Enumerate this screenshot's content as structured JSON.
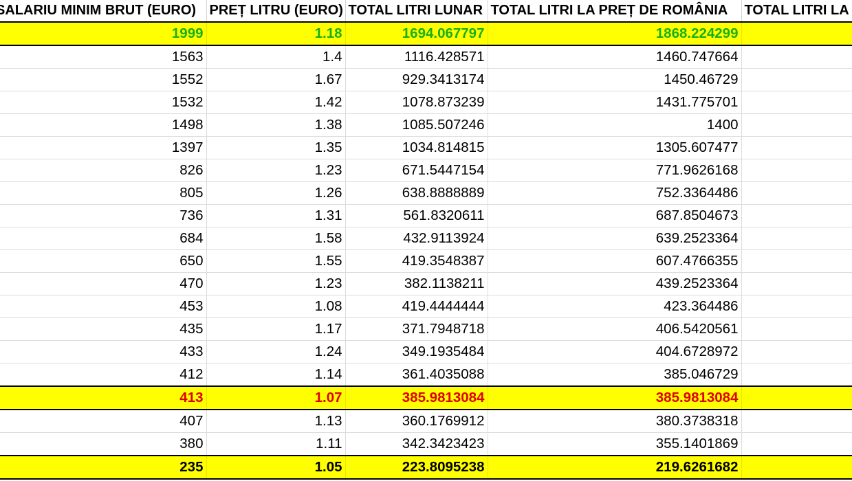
{
  "columns": [
    "SALARIU MINIM BRUT (EURO)",
    "PREȚ LITRU (EURO)",
    "TOTAL LITRI LUNAR",
    "TOTAL LITRI LA PREȚ DE ROMÂNIA",
    "TOTAL LITRI LA"
  ],
  "rows": [
    {
      "highlight": "green",
      "cells": [
        "1999",
        "1.18",
        "1694.067797",
        "1868.224299",
        ""
      ]
    },
    {
      "highlight": "",
      "cells": [
        "1563",
        "1.4",
        "1116.428571",
        "1460.747664",
        ""
      ]
    },
    {
      "highlight": "",
      "cells": [
        "1552",
        "1.67",
        "929.3413174",
        "1450.46729",
        ""
      ]
    },
    {
      "highlight": "",
      "cells": [
        "1532",
        "1.42",
        "1078.873239",
        "1431.775701",
        ""
      ]
    },
    {
      "highlight": "",
      "cells": [
        "1498",
        "1.38",
        "1085.507246",
        "1400",
        ""
      ]
    },
    {
      "highlight": "",
      "cells": [
        "1397",
        "1.35",
        "1034.814815",
        "1305.607477",
        ""
      ]
    },
    {
      "highlight": "",
      "cells": [
        "826",
        "1.23",
        "671.5447154",
        "771.9626168",
        ""
      ]
    },
    {
      "highlight": "",
      "cells": [
        "805",
        "1.26",
        "638.8888889",
        "752.3364486",
        ""
      ]
    },
    {
      "highlight": "",
      "cells": [
        "736",
        "1.31",
        "561.8320611",
        "687.8504673",
        ""
      ]
    },
    {
      "highlight": "",
      "cells": [
        "684",
        "1.58",
        "432.9113924",
        "639.2523364",
        ""
      ]
    },
    {
      "highlight": "",
      "cells": [
        "650",
        "1.55",
        "419.3548387",
        "607.4766355",
        ""
      ]
    },
    {
      "highlight": "",
      "cells": [
        "470",
        "1.23",
        "382.1138211",
        "439.2523364",
        ""
      ]
    },
    {
      "highlight": "",
      "cells": [
        "453",
        "1.08",
        "419.4444444",
        "423.364486",
        ""
      ]
    },
    {
      "highlight": "",
      "cells": [
        "435",
        "1.17",
        "371.7948718",
        "406.5420561",
        ""
      ]
    },
    {
      "highlight": "",
      "cells": [
        "433",
        "1.24",
        "349.1935484",
        "404.6728972",
        ""
      ]
    },
    {
      "highlight": "",
      "cells": [
        "412",
        "1.14",
        "361.4035088",
        "385.046729",
        ""
      ]
    },
    {
      "highlight": "red",
      "cells": [
        "413",
        "1.07",
        "385.9813084",
        "385.9813084",
        ""
      ]
    },
    {
      "highlight": "",
      "cells": [
        "407",
        "1.13",
        "360.1769912",
        "380.3738318",
        ""
      ]
    },
    {
      "highlight": "",
      "cells": [
        "380",
        "1.11",
        "342.3423423",
        "355.1401869",
        ""
      ]
    },
    {
      "highlight": "black",
      "cells": [
        "235",
        "1.05",
        "223.8095238",
        "219.6261682",
        ""
      ]
    }
  ],
  "colors": {
    "highlight_fill": "#ffff00",
    "green_text": "#16b016",
    "red_text": "#e00000",
    "grid": "#dcdcdc"
  }
}
